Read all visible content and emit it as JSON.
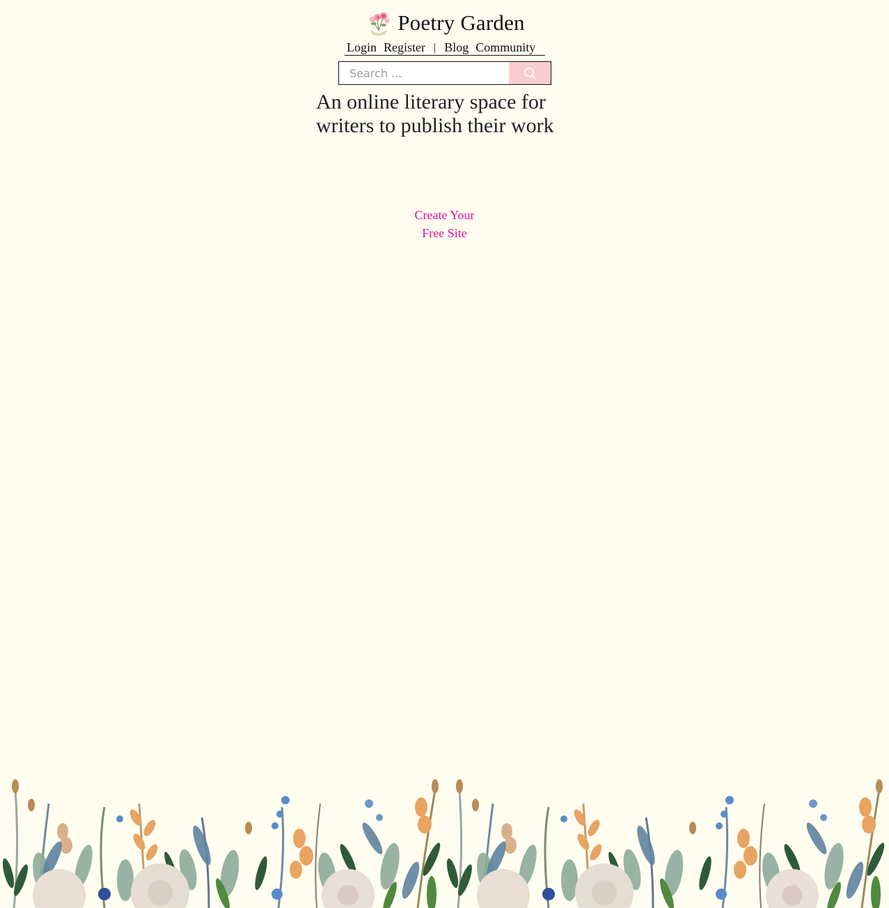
{
  "site": {
    "title": "Poetry Garden"
  },
  "nav": {
    "login": "Login",
    "register": "Register",
    "separator": "|",
    "blog": "Blog",
    "community": "Community"
  },
  "search": {
    "placeholder": "Search ...",
    "value": "",
    "icon": "search-icon"
  },
  "hero": {
    "tagline_line1": "An online literary space for",
    "tagline_line2": "writers to publish their work",
    "cta_line1": "Create Your",
    "cta_line2": "Free Site"
  },
  "colors": {
    "background": "#fffdf0",
    "accent_pink": "#e0119a",
    "search_button": "#f9cdd0",
    "text": "#111111"
  }
}
